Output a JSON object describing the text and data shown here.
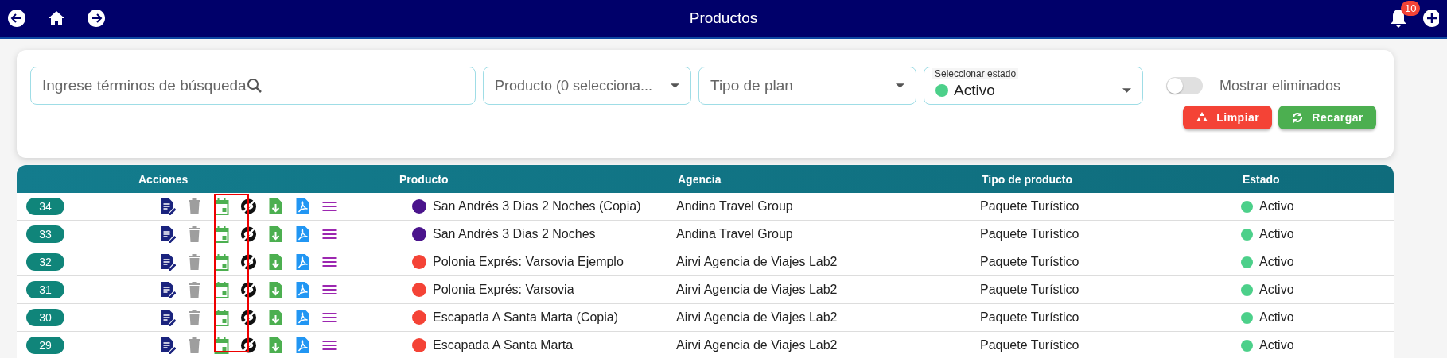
{
  "header": {
    "title": "Productos",
    "notifications": "10"
  },
  "filters": {
    "search": {
      "placeholder": "Ingrese términos de búsqueda"
    },
    "product": {
      "placeholder": "Producto (0 selecciona..."
    },
    "plan": {
      "placeholder": "Tipo de plan"
    },
    "status": {
      "label": "Seleccionar estado",
      "value": "Activo",
      "color": "#4cd08a"
    },
    "toggle": {
      "label": "Mostrar eliminados",
      "on": false
    },
    "buttons": [
      {
        "label": "Limpiar",
        "kind": "clear"
      },
      {
        "label": "Recargar",
        "kind": "reload"
      }
    ]
  },
  "table": {
    "columns": [
      "Acciones",
      "Producto",
      "Agencia",
      "Tipo de producto",
      "Estado"
    ],
    "rows": [
      {
        "id": "34",
        "product": "San Andrés 3 Dias 2 Noches (Copia)",
        "color": "#4a148c",
        "agency": "Andina Travel Group",
        "type": "Paquete Turístico",
        "status": "Activo"
      },
      {
        "id": "33",
        "product": "San Andrés 3 Dias 2 Noches",
        "color": "#4a148c",
        "agency": "Andina Travel Group",
        "type": "Paquete Turístico",
        "status": "Activo"
      },
      {
        "id": "32",
        "product": "Polonia Exprés: Varsovia Ejemplo",
        "color": "#f44336",
        "agency": "Airvi Agencia de Viajes Lab2",
        "type": "Paquete Turístico",
        "status": "Activo"
      },
      {
        "id": "31",
        "product": "Polonia Exprés: Varsovia",
        "color": "#f44336",
        "agency": "Airvi Agencia de Viajes Lab2",
        "type": "Paquete Turístico",
        "status": "Activo"
      },
      {
        "id": "30",
        "product": "Escapada A Santa Marta (Copia)",
        "color": "#f44336",
        "agency": "Airvi Agencia de Viajes Lab2",
        "type": "Paquete Turístico",
        "status": "Activo"
      },
      {
        "id": "29",
        "product": "Escapada A Santa Marta",
        "color": "#f44336",
        "agency": "Airvi Agencia de Viajes Lab2",
        "type": "Paquete Turístico",
        "status": "Activo"
      }
    ]
  }
}
